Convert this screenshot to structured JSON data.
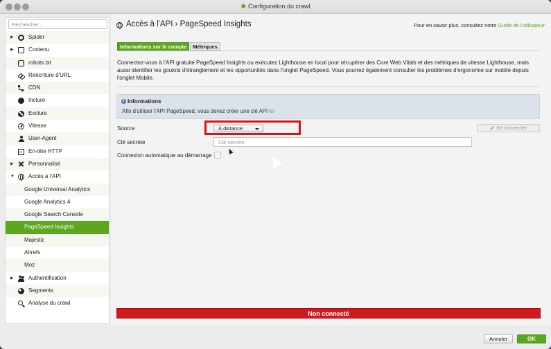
{
  "window": {
    "title": "Configuration du crawl"
  },
  "sidebar": {
    "search_placeholder": "Rechercher...",
    "items": [
      {
        "label": "Spider",
        "icon": "gear-icon",
        "expandable": true
      },
      {
        "label": "Contenu",
        "icon": "content-icon",
        "expandable": true
      },
      {
        "label": "robots.txt",
        "icon": "robot-icon"
      },
      {
        "label": "Réécriture d'URL",
        "icon": "link-icon"
      },
      {
        "label": "CDN",
        "icon": "cdn-icon"
      },
      {
        "label": "Inclure",
        "icon": "include-icon"
      },
      {
        "label": "Exclure",
        "icon": "exclude-icon"
      },
      {
        "label": "Vitesse",
        "icon": "speed-icon"
      },
      {
        "label": "User-Agent",
        "icon": "user-icon"
      },
      {
        "label": "En-tête HTTP",
        "icon": "header-icon"
      },
      {
        "label": "Personnalisé",
        "icon": "tools-icon",
        "expandable": true
      },
      {
        "label": "Accès à l'API",
        "icon": "globe-icon",
        "expanded": true
      },
      {
        "label": "Google Universal Analytics",
        "child": true
      },
      {
        "label": "Google Analytics 4",
        "child": true
      },
      {
        "label": "Google Search Console",
        "child": true
      },
      {
        "label": "PageSpeed Insights",
        "child": true,
        "active": true
      },
      {
        "label": "Majestic",
        "child": true
      },
      {
        "label": "Ahrefs",
        "child": true
      },
      {
        "label": "Moz",
        "child": true
      },
      {
        "label": "Authentification",
        "icon": "users-icon",
        "expandable": true
      },
      {
        "label": "Segments",
        "icon": "pie-icon"
      },
      {
        "label": "Analyse du crawl",
        "icon": "search-icon"
      }
    ]
  },
  "main": {
    "breadcrumb": "Accès à l'API  ›  PageSpeed Insights",
    "help_prefix": "Pour en savoir plus, consultez notre ",
    "help_link": "Guide de l'utilisateur",
    "tabs": [
      "Informations sur le compte",
      "Métriques"
    ],
    "description": "Connectez-vous à l'API gratuite PageSpeed Insights ou exécutez Lighthouse en local pour récupérer des Core Web Vitals et des métriques de vitesse Lighthouse, mais aussi identifier les goulots d'étranglement et les opportunités dans l'onglet PageSpeed. Vous pourrez également consulter les problèmes d'ergonomie sur mobile depuis l'onglet Mobile.",
    "info_title": "Informations",
    "info_text": "Afin d'utiliser l'API PageSpeed, vous devez créer une clé API ",
    "info_link": "ici",
    "source_label": "Source",
    "source_value": "À distance",
    "connect_label": "Se connecter",
    "secret_label": "Clé secrète",
    "secret_placeholder": "Clé secrète",
    "auto_connect_label": "Connexion automatique au démarrage",
    "status": "Non connecté"
  },
  "footer": {
    "cancel": "Annuler",
    "ok": "OK"
  },
  "colors": {
    "accent_green": "#5ba81e",
    "status_red": "#d11a1d",
    "highlight_red": "#e0101a"
  }
}
